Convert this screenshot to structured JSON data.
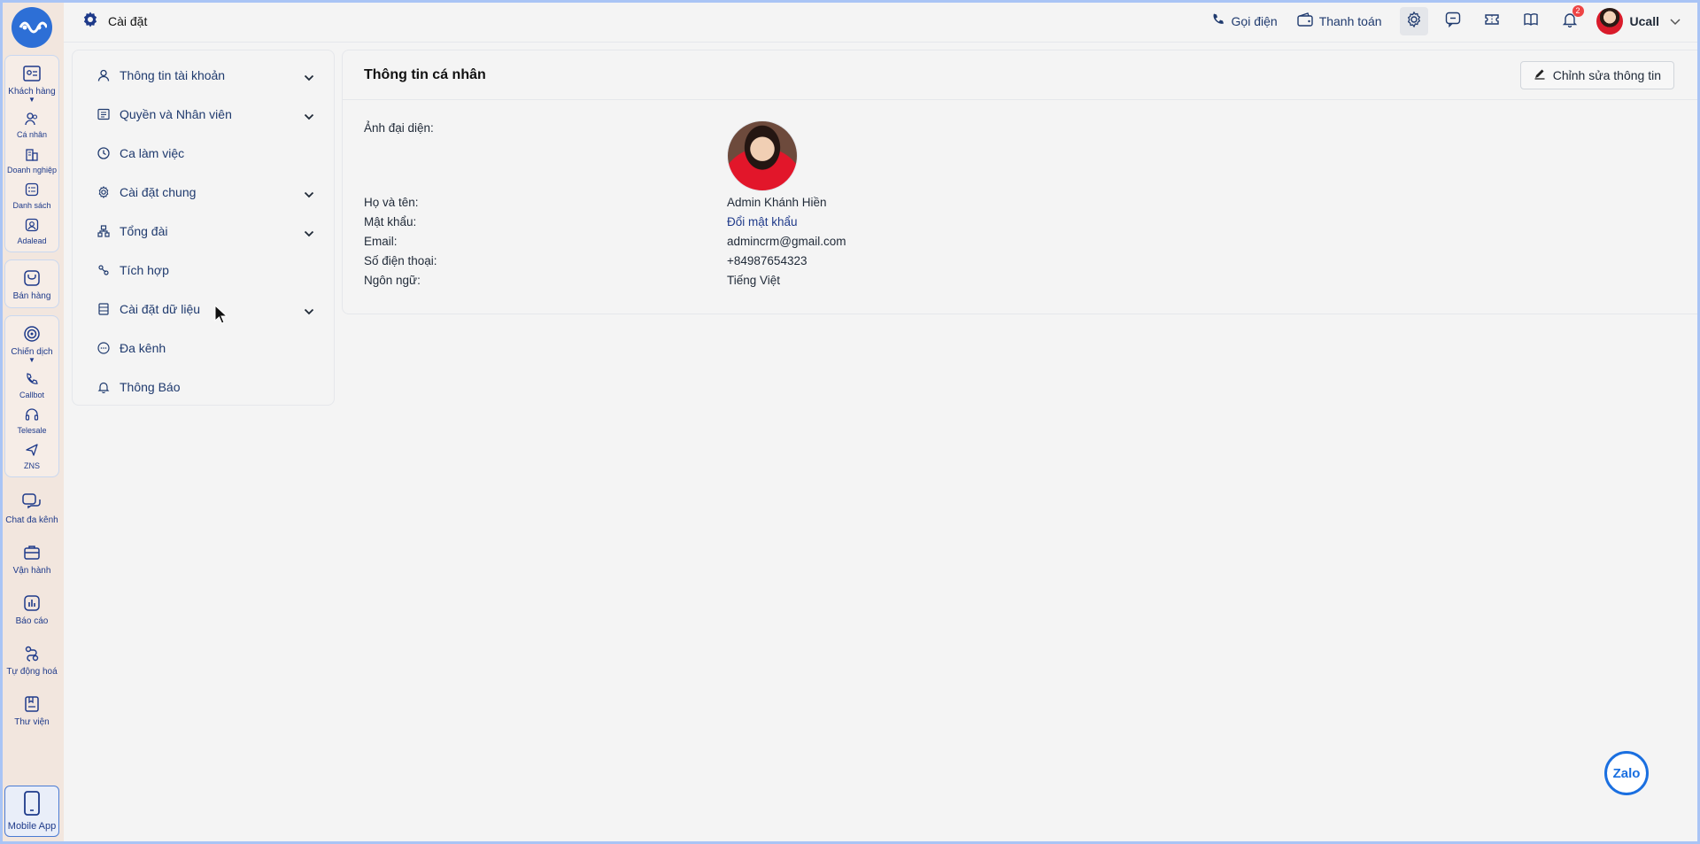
{
  "header": {
    "title": "Cài đặt",
    "call_label": "Gọi điện",
    "payment_label": "Thanh toán",
    "notification_count": "2",
    "user_name": "Ucall"
  },
  "rail": {
    "groups": [
      [
        {
          "label": "Khách hàng",
          "icon": "contact-card-icon",
          "caret": true
        },
        {
          "label": "Cá nhân",
          "icon": "people-icon"
        },
        {
          "label": "Doanh nghiệp",
          "icon": "building-icon"
        },
        {
          "label": "Danh sách",
          "icon": "list-icon"
        },
        {
          "label": "Adalead",
          "icon": "user-square-icon"
        }
      ]
    ],
    "sales_label": "Bán hàng",
    "campaign": [
      {
        "label": "Chiến dịch",
        "icon": "target-icon",
        "caret": true
      },
      {
        "label": "Callbot",
        "icon": "phone-icon"
      },
      {
        "label": "Telesale",
        "icon": "headset-icon"
      },
      {
        "label": "ZNS",
        "icon": "send-icon"
      }
    ],
    "others": [
      {
        "label": "Chat đa kênh",
        "icon": "chat-icon"
      },
      {
        "label": "Vận hành",
        "icon": "briefcase-icon"
      },
      {
        "label": "Báo cáo",
        "icon": "chart-icon"
      },
      {
        "label": "Tự động hoá",
        "icon": "flow-icon"
      },
      {
        "label": "Thư viện",
        "icon": "book-icon"
      }
    ],
    "mobile_app_label": "Mobile App"
  },
  "menu": {
    "items": [
      {
        "label": "Thông tin tài khoản",
        "icon": "user-icon",
        "expandable": true
      },
      {
        "label": "Quyền và Nhân viên",
        "icon": "id-card-icon",
        "expandable": true
      },
      {
        "label": "Ca làm việc",
        "icon": "clock-icon",
        "expandable": false
      },
      {
        "label": "Cài đặt chung",
        "icon": "gear-icon",
        "expandable": true
      },
      {
        "label": "Tổng đài",
        "icon": "network-icon",
        "expandable": true
      },
      {
        "label": "Tích hợp",
        "icon": "link-icon",
        "expandable": false
      },
      {
        "label": "Cài đặt dữ liệu",
        "icon": "database-icon",
        "expandable": true
      },
      {
        "label": "Đa kênh",
        "icon": "chat-dots-icon",
        "expandable": false
      },
      {
        "label": "Thông Báo",
        "icon": "bell-icon",
        "expandable": false
      }
    ]
  },
  "profile": {
    "title": "Thông tin cá nhân",
    "edit_label": "Chỉnh sửa thông tin",
    "avatar_label": "Ảnh đại diện:",
    "fields": [
      {
        "label": "Họ và tên:",
        "value": "Admin Khánh Hiền"
      },
      {
        "label": "Mật khẩu:",
        "value": "Đổi mật khẩu"
      },
      {
        "label": "Email:",
        "value": "admincrm@gmail.com"
      },
      {
        "label": "Số điện thoại:",
        "value": "+84987654323"
      },
      {
        "label": "Ngôn ngữ:",
        "value": "Tiếng Việt"
      }
    ]
  },
  "zalo_label": "Zalo",
  "colors": {
    "accent": "#1f3a8a",
    "rail_bg": "#f2e6de",
    "page_bg": "#f4f4f4"
  }
}
